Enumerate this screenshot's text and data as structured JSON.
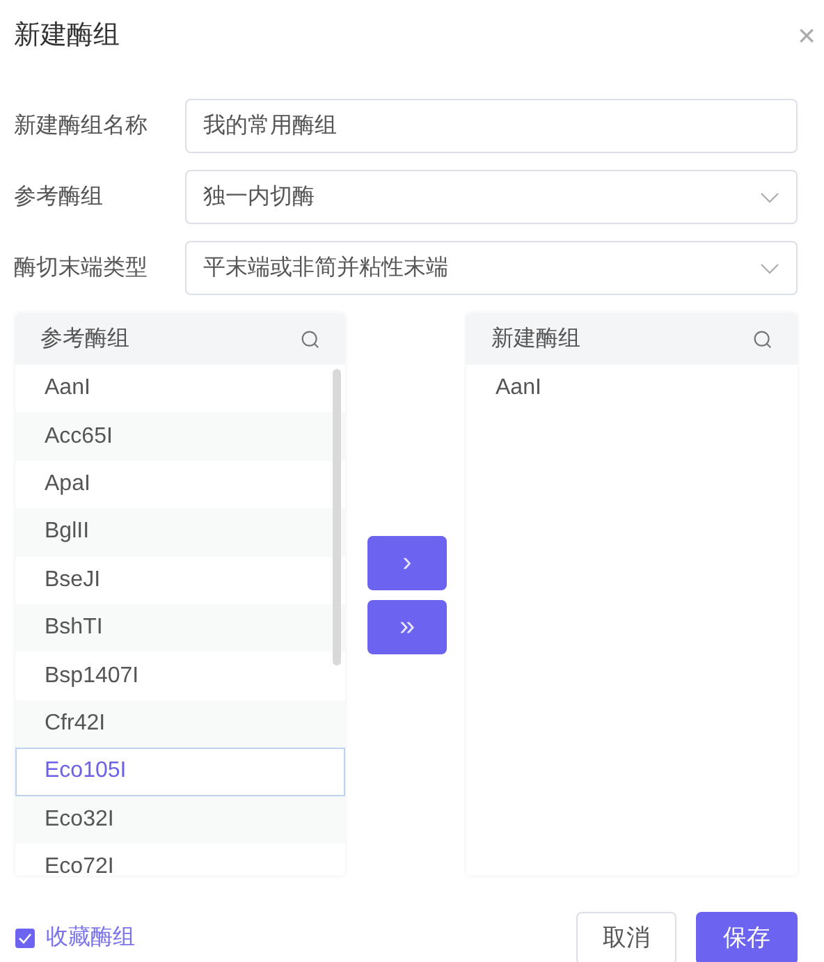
{
  "dialog": {
    "title": "新建酶组",
    "close": "×"
  },
  "fields": [
    {
      "kind": "text",
      "label": "新建酶组名称",
      "value": "我的常用酶组"
    },
    {
      "kind": "select",
      "label": "参考酶组",
      "value": "独一内切酶"
    },
    {
      "kind": "select",
      "label": "酶切末端类型",
      "value": "平末端或非简并粘性末端"
    }
  ],
  "source_list": {
    "title": "参考酶组",
    "items": [
      {
        "label": "AanI",
        "selected": false
      },
      {
        "label": "Acc65I",
        "selected": false
      },
      {
        "label": "ApaI",
        "selected": false
      },
      {
        "label": "BglII",
        "selected": false
      },
      {
        "label": "BseJI",
        "selected": false
      },
      {
        "label": "BshTI",
        "selected": false
      },
      {
        "label": "Bsp1407I",
        "selected": false
      },
      {
        "label": "Cfr42I",
        "selected": false
      },
      {
        "label": "Eco105I",
        "selected": true
      },
      {
        "label": "Eco32I",
        "selected": false
      },
      {
        "label": "Eco72I",
        "selected": false
      }
    ]
  },
  "transfer_buttons": [
    "›",
    "»"
  ],
  "target_list": {
    "title": "新建酶组",
    "items": [
      {
        "label": "AanI",
        "selected": false
      }
    ]
  },
  "favorite": {
    "label": "收藏酶组",
    "checked": true
  },
  "buttons": [
    {
      "kind": "secondary",
      "label": "取消"
    },
    {
      "kind": "primary",
      "label": "保存"
    }
  ]
}
